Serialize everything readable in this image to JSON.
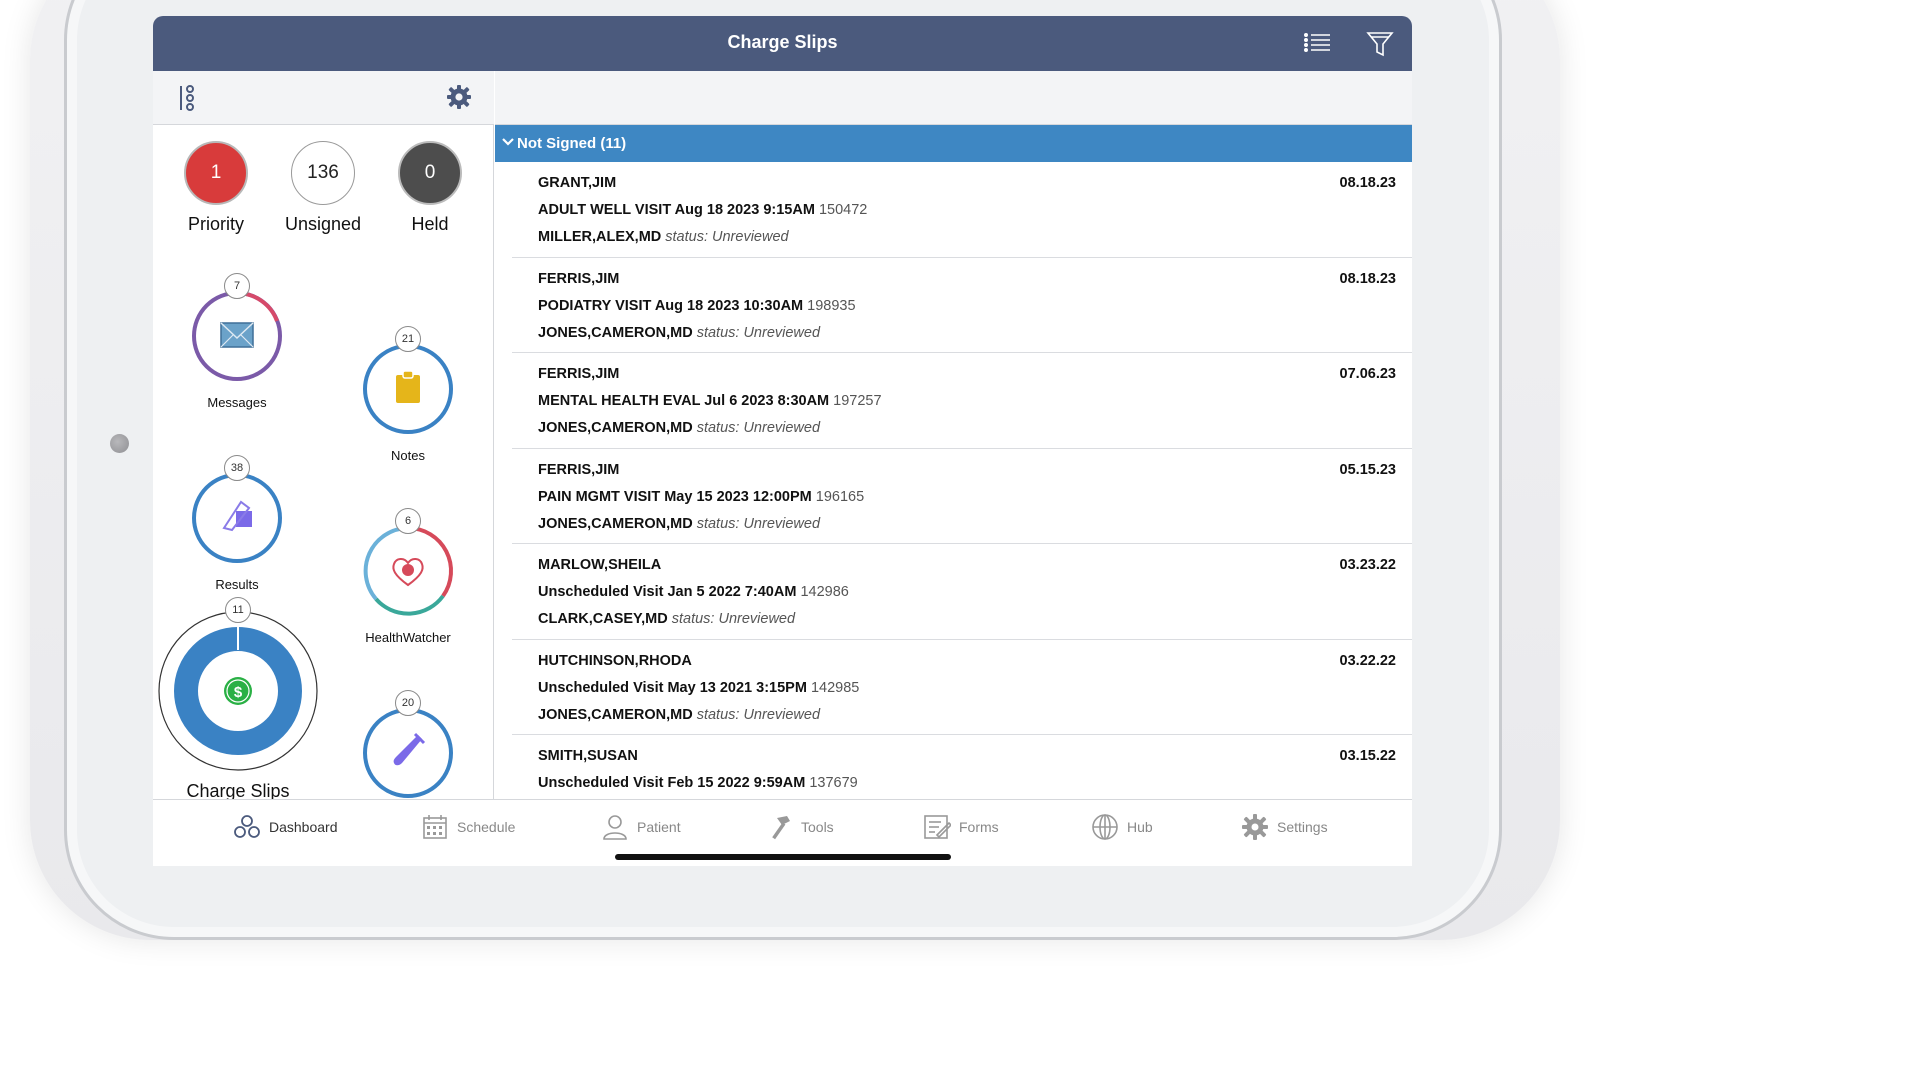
{
  "header": {
    "title": "Charge Slips"
  },
  "counters": {
    "priority": {
      "value": "1",
      "label": "Priority"
    },
    "unsigned": {
      "value": "136",
      "label": "Unsigned"
    },
    "held": {
      "value": "0",
      "label": "Held"
    }
  },
  "widgets": {
    "messages": {
      "count": "7",
      "label": "Messages"
    },
    "notes": {
      "count": "21",
      "label": "Notes"
    },
    "results": {
      "count": "38",
      "label": "Results"
    },
    "healthwatcher": {
      "count": "6",
      "label": "HealthWatcher"
    },
    "charge_slips": {
      "count": "11",
      "label": "Charge Slips"
    },
    "labs": {
      "count": "20"
    }
  },
  "group": {
    "label": "Not Signed (11)"
  },
  "slips": [
    {
      "patient": "GRANT,JIM",
      "visit": "ADULT WELL VISIT Aug 18 2023  9:15AM",
      "id": "150472",
      "provider": "MILLER,ALEX,MD",
      "status": "status: Unreviewed",
      "date": "08.18.23"
    },
    {
      "patient": "FERRIS,JIM",
      "visit": "PODIATRY VISIT Aug 18 2023 10:30AM",
      "id": "198935",
      "provider": "JONES,CAMERON,MD",
      "status": "status: Unreviewed",
      "date": "08.18.23"
    },
    {
      "patient": "FERRIS,JIM",
      "visit": "MENTAL HEALTH EVAL Jul  6 2023  8:30AM",
      "id": "197257",
      "provider": "JONES,CAMERON,MD",
      "status": "status: Unreviewed",
      "date": "07.06.23"
    },
    {
      "patient": "FERRIS,JIM",
      "visit": "PAIN MGMT VISIT May 15 2023 12:00PM",
      "id": "196165",
      "provider": "JONES,CAMERON,MD",
      "status": "status: Unreviewed",
      "date": "05.15.23"
    },
    {
      "patient": "MARLOW,SHEILA",
      "visit": "Unscheduled Visit Jan  5 2022  7:40AM",
      "id": "142986",
      "provider": "CLARK,CASEY,MD",
      "status": "status: Unreviewed",
      "date": "03.23.22"
    },
    {
      "patient": "HUTCHINSON,RHODA",
      "visit": "Unscheduled Visit May 13 2021  3:15PM",
      "id": "142985",
      "provider": "JONES,CAMERON,MD",
      "status": "status: Unreviewed",
      "date": "03.22.22"
    },
    {
      "patient": "SMITH,SUSAN",
      "visit": "Unscheduled Visit Feb 15 2022  9:59AM",
      "id": "137679",
      "provider": "",
      "status": "",
      "date": "03.15.22"
    }
  ],
  "nav": {
    "dashboard": "Dashboard",
    "schedule": "Schedule",
    "patient": "Patient",
    "tools": "Tools",
    "forms": "Forms",
    "hub": "Hub",
    "settings": "Settings"
  },
  "colors": {
    "header": "#4b5a7d",
    "group": "#3e87c3",
    "priority": "#d83b3b",
    "held": "#4d4d4d",
    "charge_ring": "#3a82c4"
  }
}
